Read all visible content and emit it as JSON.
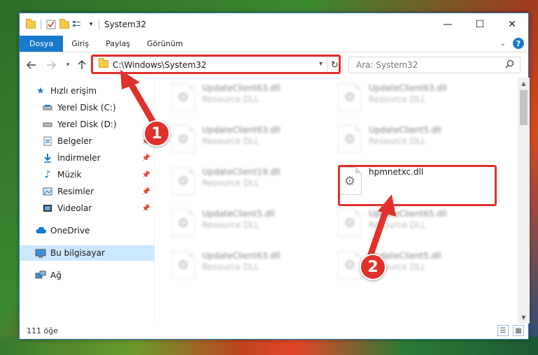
{
  "window": {
    "title": "System32",
    "minimize": "—",
    "maximize": "☐",
    "close": "✕"
  },
  "ribbon": {
    "tabs": [
      "Dosya",
      "Giriş",
      "Paylaş",
      "Görünüm"
    ],
    "help": "?"
  },
  "navigation": {
    "address": "C:\\Windows\\System32",
    "search_placeholder": "Ara: System32"
  },
  "sidebar": {
    "quick_access": "Hızlı erişim",
    "items": [
      {
        "label": "Yerel Disk (C:)",
        "icon": "drive-icon",
        "pinned": false
      },
      {
        "label": "Yerel Disk (D:)",
        "icon": "drive-icon",
        "pinned": false
      },
      {
        "label": "Belgeler",
        "icon": "documents-icon",
        "pinned": true
      },
      {
        "label": "İndirmeler",
        "icon": "downloads-icon",
        "pinned": true
      },
      {
        "label": "Müzik",
        "icon": "music-icon",
        "pinned": true
      },
      {
        "label": "Resimler",
        "icon": "pictures-icon",
        "pinned": true
      },
      {
        "label": "Videolar",
        "icon": "videos-icon",
        "pinned": true
      }
    ],
    "onedrive": "OneDrive",
    "this_pc": "Bu bilgisayar",
    "network": "Ağ"
  },
  "files": [
    {
      "name": "UpdateClient63.dll",
      "type": "Resource DLL",
      "blurred": true
    },
    {
      "name": "UpdateClient63.dll",
      "type": "Resource DLL",
      "blurred": true
    },
    {
      "name": "UpdateClient63.dll",
      "type": "Resource DLL",
      "blurred": true
    },
    {
      "name": "UpdateClient5.dll",
      "type": "Resource DLL",
      "blurred": true
    },
    {
      "name": "UpdateClient19.dll",
      "type": "Resource DLL",
      "blurred": true
    },
    {
      "name": "hpmnetxc.dll",
      "type": "",
      "blurred": false
    },
    {
      "name": "UpdateClient5.dll",
      "type": "Resource DLL",
      "blurred": true
    },
    {
      "name": "UpdateClient65.dll",
      "type": "Resource DLL",
      "blurred": true
    },
    {
      "name": "UpdateClient63.dll",
      "type": "Resource DLL",
      "blurred": true
    },
    {
      "name": "UpdateClient5.dll",
      "type": "Resource DLL",
      "blurred": true
    }
  ],
  "status": {
    "item_count": "111 öğe"
  },
  "annotations": {
    "badge_1": "1",
    "badge_2": "2",
    "color": "#e0312d"
  }
}
